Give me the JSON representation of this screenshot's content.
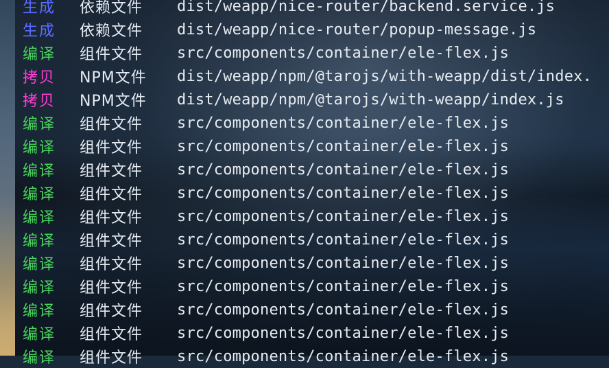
{
  "colors": {
    "generate": "#5b6cff",
    "compile": "#47d65a",
    "copy": "#ff3fd6",
    "text": "#e6ebf1"
  },
  "rows": [
    {
      "tag": "生成",
      "tag_color": "#5b6cff",
      "type": "依赖文件",
      "path": "dist/weapp/nice-router/backend.service.js"
    },
    {
      "tag": "生成",
      "tag_color": "#5b6cff",
      "type": "依赖文件",
      "path": "dist/weapp/nice-router/popup-message.js"
    },
    {
      "tag": "编译",
      "tag_color": "#47d65a",
      "type": "组件文件",
      "path": "src/components/container/ele-flex.js"
    },
    {
      "tag": "拷贝",
      "tag_color": "#ff3fd6",
      "type": "NPM文件",
      "path": "dist/weapp/npm/@tarojs/with-weapp/dist/index."
    },
    {
      "tag": "拷贝",
      "tag_color": "#ff3fd6",
      "type": "NPM文件",
      "path": "dist/weapp/npm/@tarojs/with-weapp/index.js"
    },
    {
      "tag": "编译",
      "tag_color": "#47d65a",
      "type": "组件文件",
      "path": "src/components/container/ele-flex.js"
    },
    {
      "tag": "编译",
      "tag_color": "#47d65a",
      "type": "组件文件",
      "path": "src/components/container/ele-flex.js"
    },
    {
      "tag": "编译",
      "tag_color": "#47d65a",
      "type": "组件文件",
      "path": "src/components/container/ele-flex.js"
    },
    {
      "tag": "编译",
      "tag_color": "#47d65a",
      "type": "组件文件",
      "path": "src/components/container/ele-flex.js"
    },
    {
      "tag": "编译",
      "tag_color": "#47d65a",
      "type": "组件文件",
      "path": "src/components/container/ele-flex.js"
    },
    {
      "tag": "编译",
      "tag_color": "#47d65a",
      "type": "组件文件",
      "path": "src/components/container/ele-flex.js"
    },
    {
      "tag": "编译",
      "tag_color": "#47d65a",
      "type": "组件文件",
      "path": "src/components/container/ele-flex.js"
    },
    {
      "tag": "编译",
      "tag_color": "#47d65a",
      "type": "组件文件",
      "path": "src/components/container/ele-flex.js"
    },
    {
      "tag": "编译",
      "tag_color": "#47d65a",
      "type": "组件文件",
      "path": "src/components/container/ele-flex.js"
    },
    {
      "tag": "编译",
      "tag_color": "#47d65a",
      "type": "组件文件",
      "path": "src/components/container/ele-flex.js"
    },
    {
      "tag": "编译",
      "tag_color": "#47d65a",
      "type": "组件文件",
      "path": "src/components/container/ele-flex.js"
    }
  ]
}
